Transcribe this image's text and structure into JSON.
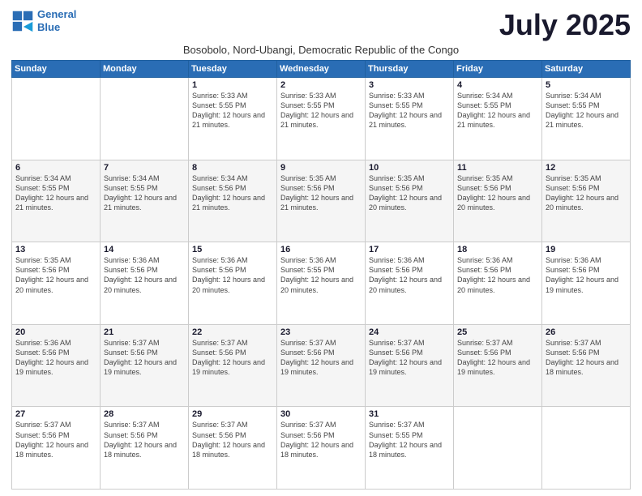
{
  "logo": {
    "line1": "General",
    "line2": "Blue"
  },
  "title": "July 2025",
  "subtitle": "Bosobolo, Nord-Ubangi, Democratic Republic of the Congo",
  "days_of_week": [
    "Sunday",
    "Monday",
    "Tuesday",
    "Wednesday",
    "Thursday",
    "Friday",
    "Saturday"
  ],
  "weeks": [
    [
      {
        "num": "",
        "info": ""
      },
      {
        "num": "",
        "info": ""
      },
      {
        "num": "1",
        "info": "Sunrise: 5:33 AM\nSunset: 5:55 PM\nDaylight: 12 hours and 21 minutes."
      },
      {
        "num": "2",
        "info": "Sunrise: 5:33 AM\nSunset: 5:55 PM\nDaylight: 12 hours and 21 minutes."
      },
      {
        "num": "3",
        "info": "Sunrise: 5:33 AM\nSunset: 5:55 PM\nDaylight: 12 hours and 21 minutes."
      },
      {
        "num": "4",
        "info": "Sunrise: 5:34 AM\nSunset: 5:55 PM\nDaylight: 12 hours and 21 minutes."
      },
      {
        "num": "5",
        "info": "Sunrise: 5:34 AM\nSunset: 5:55 PM\nDaylight: 12 hours and 21 minutes."
      }
    ],
    [
      {
        "num": "6",
        "info": "Sunrise: 5:34 AM\nSunset: 5:55 PM\nDaylight: 12 hours and 21 minutes."
      },
      {
        "num": "7",
        "info": "Sunrise: 5:34 AM\nSunset: 5:55 PM\nDaylight: 12 hours and 21 minutes."
      },
      {
        "num": "8",
        "info": "Sunrise: 5:34 AM\nSunset: 5:56 PM\nDaylight: 12 hours and 21 minutes."
      },
      {
        "num": "9",
        "info": "Sunrise: 5:35 AM\nSunset: 5:56 PM\nDaylight: 12 hours and 21 minutes."
      },
      {
        "num": "10",
        "info": "Sunrise: 5:35 AM\nSunset: 5:56 PM\nDaylight: 12 hours and 20 minutes."
      },
      {
        "num": "11",
        "info": "Sunrise: 5:35 AM\nSunset: 5:56 PM\nDaylight: 12 hours and 20 minutes."
      },
      {
        "num": "12",
        "info": "Sunrise: 5:35 AM\nSunset: 5:56 PM\nDaylight: 12 hours and 20 minutes."
      }
    ],
    [
      {
        "num": "13",
        "info": "Sunrise: 5:35 AM\nSunset: 5:56 PM\nDaylight: 12 hours and 20 minutes."
      },
      {
        "num": "14",
        "info": "Sunrise: 5:36 AM\nSunset: 5:56 PM\nDaylight: 12 hours and 20 minutes."
      },
      {
        "num": "15",
        "info": "Sunrise: 5:36 AM\nSunset: 5:56 PM\nDaylight: 12 hours and 20 minutes."
      },
      {
        "num": "16",
        "info": "Sunrise: 5:36 AM\nSunset: 5:55 PM\nDaylight: 12 hours and 20 minutes."
      },
      {
        "num": "17",
        "info": "Sunrise: 5:36 AM\nSunset: 5:56 PM\nDaylight: 12 hours and 20 minutes."
      },
      {
        "num": "18",
        "info": "Sunrise: 5:36 AM\nSunset: 5:56 PM\nDaylight: 12 hours and 20 minutes."
      },
      {
        "num": "19",
        "info": "Sunrise: 5:36 AM\nSunset: 5:56 PM\nDaylight: 12 hours and 19 minutes."
      }
    ],
    [
      {
        "num": "20",
        "info": "Sunrise: 5:36 AM\nSunset: 5:56 PM\nDaylight: 12 hours and 19 minutes."
      },
      {
        "num": "21",
        "info": "Sunrise: 5:37 AM\nSunset: 5:56 PM\nDaylight: 12 hours and 19 minutes."
      },
      {
        "num": "22",
        "info": "Sunrise: 5:37 AM\nSunset: 5:56 PM\nDaylight: 12 hours and 19 minutes."
      },
      {
        "num": "23",
        "info": "Sunrise: 5:37 AM\nSunset: 5:56 PM\nDaylight: 12 hours and 19 minutes."
      },
      {
        "num": "24",
        "info": "Sunrise: 5:37 AM\nSunset: 5:56 PM\nDaylight: 12 hours and 19 minutes."
      },
      {
        "num": "25",
        "info": "Sunrise: 5:37 AM\nSunset: 5:56 PM\nDaylight: 12 hours and 19 minutes."
      },
      {
        "num": "26",
        "info": "Sunrise: 5:37 AM\nSunset: 5:56 PM\nDaylight: 12 hours and 18 minutes."
      }
    ],
    [
      {
        "num": "27",
        "info": "Sunrise: 5:37 AM\nSunset: 5:56 PM\nDaylight: 12 hours and 18 minutes."
      },
      {
        "num": "28",
        "info": "Sunrise: 5:37 AM\nSunset: 5:56 PM\nDaylight: 12 hours and 18 minutes."
      },
      {
        "num": "29",
        "info": "Sunrise: 5:37 AM\nSunset: 5:56 PM\nDaylight: 12 hours and 18 minutes."
      },
      {
        "num": "30",
        "info": "Sunrise: 5:37 AM\nSunset: 5:56 PM\nDaylight: 12 hours and 18 minutes."
      },
      {
        "num": "31",
        "info": "Sunrise: 5:37 AM\nSunset: 5:55 PM\nDaylight: 12 hours and 18 minutes."
      },
      {
        "num": "",
        "info": ""
      },
      {
        "num": "",
        "info": ""
      }
    ]
  ]
}
